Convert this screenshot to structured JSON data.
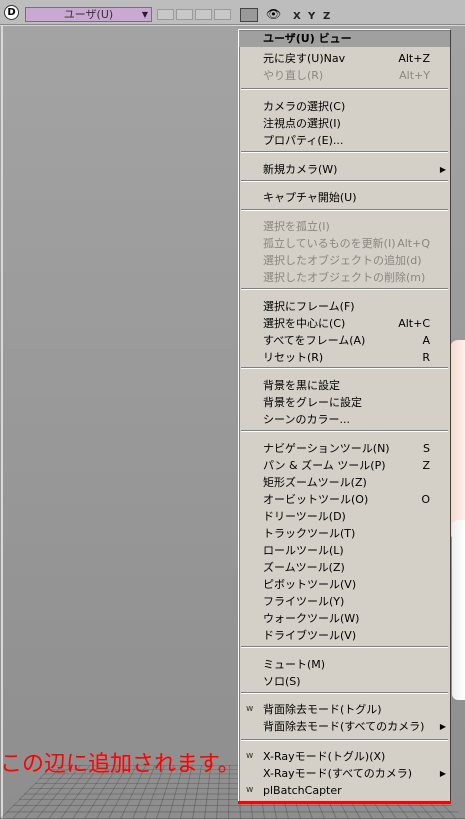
{
  "toolbar": {
    "logo": "D",
    "view_label": "ユーザ(U)",
    "axes": [
      "X",
      "Y",
      "Z"
    ]
  },
  "menu": {
    "header": "ユーザ(U) ビュー",
    "items": [
      {
        "label": "元に戻す(U)Nav",
        "shortcut": "Alt+Z",
        "disabled": false
      },
      {
        "label": "やり直し(R)",
        "shortcut": "Alt+Y",
        "disabled": true
      },
      {
        "label": "カメラの選択(C)",
        "shortcut": "",
        "disabled": false
      },
      {
        "label": "注視点の選択(I)",
        "shortcut": "",
        "disabled": false
      },
      {
        "label": "プロパティ(E)...",
        "shortcut": "",
        "disabled": false
      },
      {
        "label": "新規カメラ(W)",
        "shortcut": "",
        "disabled": false,
        "submenu": true
      },
      {
        "label": "キャプチャ開始(U)",
        "shortcut": "",
        "disabled": false
      },
      {
        "label": "選択を孤立(I)",
        "shortcut": "",
        "disabled": true
      },
      {
        "label": "孤立しているものを更新(I)",
        "shortcut": "Alt+Q",
        "disabled": true
      },
      {
        "label": "選択したオブジェクトの追加(d)",
        "shortcut": "",
        "disabled": true
      },
      {
        "label": "選択したオブジェクトの削除(m)",
        "shortcut": "",
        "disabled": true
      },
      {
        "label": "選択にフレーム(F)",
        "shortcut": "",
        "disabled": false
      },
      {
        "label": "選択を中心に(C)",
        "shortcut": "Alt+C",
        "disabled": false
      },
      {
        "label": "すべてをフレーム(A)",
        "shortcut": "A",
        "disabled": false
      },
      {
        "label": "リセット(R)",
        "shortcut": "R",
        "disabled": false
      },
      {
        "label": "背景を黒に設定",
        "shortcut": "",
        "disabled": false
      },
      {
        "label": "背景をグレーに設定",
        "shortcut": "",
        "disabled": false
      },
      {
        "label": "シーンのカラー...",
        "shortcut": "",
        "disabled": false
      },
      {
        "label": "ナビゲーションツール(N)",
        "shortcut": "S",
        "disabled": false
      },
      {
        "label": "パン & ズーム ツール(P)",
        "shortcut": "Z",
        "disabled": false
      },
      {
        "label": "矩形ズームツール(Z)",
        "shortcut": "",
        "disabled": false
      },
      {
        "label": "オービットツール(O)",
        "shortcut": "O",
        "disabled": false
      },
      {
        "label": "ドリーツール(D)",
        "shortcut": "",
        "disabled": false
      },
      {
        "label": "トラックツール(T)",
        "shortcut": "",
        "disabled": false
      },
      {
        "label": "ロールツール(L)",
        "shortcut": "",
        "disabled": false
      },
      {
        "label": "ズームツール(Z)",
        "shortcut": "",
        "disabled": false
      },
      {
        "label": "ピボットツール(V)",
        "shortcut": "",
        "disabled": false
      },
      {
        "label": "フライツール(Y)",
        "shortcut": "",
        "disabled": false
      },
      {
        "label": "ウォークツール(W)",
        "shortcut": "",
        "disabled": false
      },
      {
        "label": "ドライブツール(V)",
        "shortcut": "",
        "disabled": false
      },
      {
        "label": "ミュート(M)",
        "shortcut": "",
        "disabled": false
      },
      {
        "label": "ソロ(S)",
        "shortcut": "",
        "disabled": false
      },
      {
        "label": "背面除去モード(トグル)",
        "shortcut": "",
        "disabled": false,
        "mark": "w"
      },
      {
        "label": "背面除去モード(すべてのカメラ)",
        "shortcut": "",
        "disabled": false,
        "submenu": true
      },
      {
        "label": "X-Rayモード(トグル)(X)",
        "shortcut": "",
        "disabled": false,
        "mark": "w"
      },
      {
        "label": "X-Rayモード(すべてのカメラ)",
        "shortcut": "",
        "disabled": false,
        "submenu": true
      },
      {
        "label": "plBatchCapter",
        "shortcut": "",
        "disabled": false,
        "mark": "w"
      }
    ]
  },
  "annotation": {
    "text": "この辺に追加されます。",
    "color": "#ff0000"
  },
  "colors": {
    "menu_bg": "#d4d0c8",
    "header_bg": "#a0a0a0",
    "view_select_bg": "#c9a9d2",
    "disabled_text": "#8a8680"
  }
}
